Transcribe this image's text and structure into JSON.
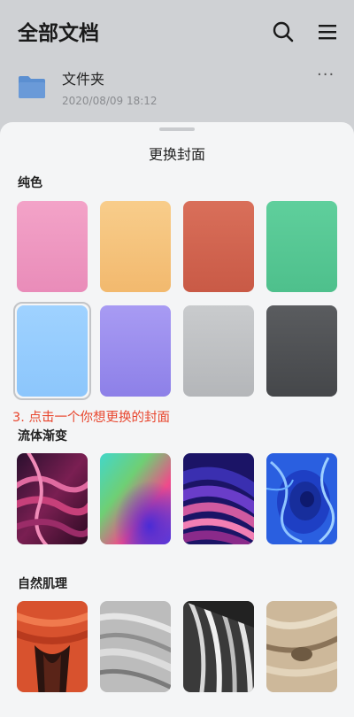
{
  "header": {
    "title": "全部文档"
  },
  "file": {
    "name": "文件夹",
    "date": "2020/08/09 18:12",
    "more": "···"
  },
  "sheet": {
    "title": "更换封面",
    "sections": {
      "solid": "纯色",
      "gradient": "流体渐变",
      "texture": "自然肌理"
    },
    "hint": "3. 点击一个你想更换的封面",
    "solid_colors": [
      {
        "top": "#f3a3c8",
        "bottom": "#e98cb9"
      },
      {
        "top": "#f8cd8b",
        "bottom": "#f2b96e"
      },
      {
        "top": "#d96f5a",
        "bottom": "#c95a46"
      },
      {
        "top": "#5fcf9c",
        "bottom": "#4ec08c"
      },
      {
        "top": "#9fd2ff",
        "bottom": "#8cc6fc"
      },
      {
        "top": "#a89bf3",
        "bottom": "#8d80e8"
      },
      {
        "top": "#c9cbcd",
        "bottom": "#b4b6b9"
      },
      {
        "top": "#5a5c5f",
        "bottom": "#45474a"
      }
    ],
    "selected_index": 4
  },
  "icons": {
    "search": "search-icon",
    "menu": "menu-icon",
    "folder": "folder-icon"
  }
}
